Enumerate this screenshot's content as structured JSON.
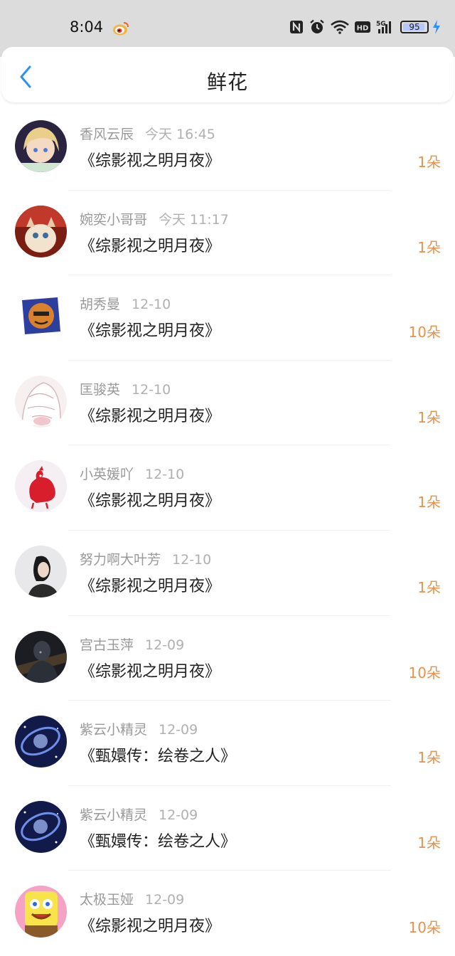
{
  "status_bar": {
    "time": "8:04",
    "battery": "95",
    "battery_level": 0.95,
    "icons": [
      "weibo-icon",
      "nfc-icon",
      "alarm-icon",
      "wifi-icon",
      "hd-icon",
      "signal-5g-icon",
      "battery-icon",
      "charging-icon"
    ]
  },
  "header": {
    "title": "鲜花",
    "back_icon": "chevron-left-icon",
    "accent_color": "#2f8ff5"
  },
  "colors": {
    "amount": "#e8914a",
    "meta": "#999999"
  },
  "records": [
    {
      "name": "香风云辰",
      "time": "今天 16:45",
      "work": "《综影视之明月夜》",
      "amount": "1朵"
    },
    {
      "name": "婉奕小哥哥",
      "time": "今天 11:17",
      "work": "《综影视之明月夜》",
      "amount": "1朵"
    },
    {
      "name": "胡秀曼",
      "time": "12-10",
      "work": "《综影视之明月夜》",
      "amount": "10朵"
    },
    {
      "name": "匡骏英",
      "time": "12-10",
      "work": "《综影视之明月夜》",
      "amount": "1朵"
    },
    {
      "name": "小英媛吖",
      "time": "12-10",
      "work": "《综影视之明月夜》",
      "amount": "1朵"
    },
    {
      "name": "努力啊大叶芳",
      "time": "12-10",
      "work": "《综影视之明月夜》",
      "amount": "1朵"
    },
    {
      "name": "宫古玉萍",
      "time": "12-09",
      "work": "《综影视之明月夜》",
      "amount": "10朵"
    },
    {
      "name": "紫云小精灵",
      "time": "12-09",
      "work": "《甄嬛传：绘卷之人》",
      "amount": "1朵"
    },
    {
      "name": "紫云小精灵",
      "time": "12-09",
      "work": "《甄嬛传：绘卷之人》",
      "amount": "1朵"
    },
    {
      "name": "太极玉娅",
      "time": "12-09",
      "work": "《综影视之明月夜》",
      "amount": "10朵"
    }
  ]
}
